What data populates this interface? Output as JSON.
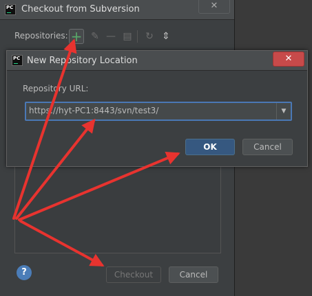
{
  "checkout": {
    "title": "Checkout from Subversion",
    "close_icon": "✕",
    "repositories_label": "Repositories:",
    "help_label": "?",
    "checkout_button": "Checkout",
    "cancel_button": "Cancel"
  },
  "new_repo": {
    "title": "New Repository Location",
    "close_icon": "✕",
    "url_label": "Repository URL:",
    "url_value": "https://hyt-PC1:8443/svn/test3/",
    "ok_button": "OK",
    "cancel_button": "Cancel"
  },
  "logo_text": "PC",
  "colors": {
    "annotation_arrow": "#e8332f",
    "ok_button": "#365880",
    "focus_border": "#4a78b5",
    "add_icon": "#59a869"
  },
  "icons": [
    "plus-icon",
    "edit-icon",
    "minus-icon",
    "copy-icon",
    "refresh-icon",
    "collapse-icon",
    "help-icon",
    "dropdown-arrow-icon"
  ]
}
